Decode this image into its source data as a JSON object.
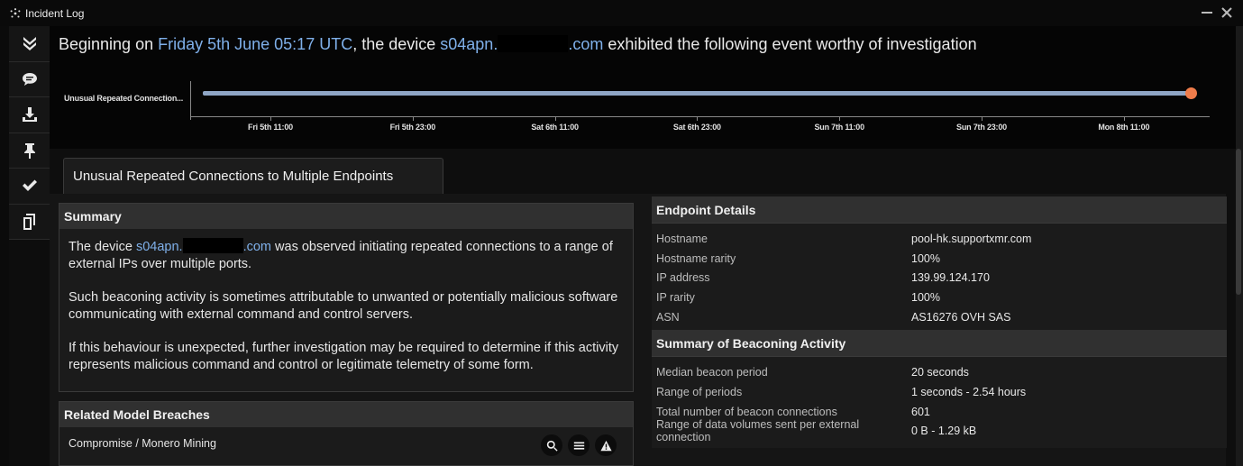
{
  "window": {
    "title": "Incident Log"
  },
  "sidebar": {
    "items": [
      {
        "icon": "collapse-chevrons-icon",
        "label": "Collapse"
      },
      {
        "icon": "comment-icon",
        "label": "Comment"
      },
      {
        "icon": "download-icon",
        "label": "Download"
      },
      {
        "icon": "pin-icon",
        "label": "Pin"
      },
      {
        "icon": "checkmark-icon",
        "label": "Acknowledge"
      },
      {
        "icon": "copy-icon",
        "label": "Copy"
      }
    ]
  },
  "headline": {
    "prefix": "Beginning on ",
    "date": "Friday 5th June 05:17 UTC",
    "middle": ", the device ",
    "device_prefix": "s04apn.",
    "device_suffix": ".com",
    "suffix": " exhibited the following event worthy of investigation"
  },
  "timeline": {
    "label": "Unusual Repeated Connection...",
    "dates": [
      "Fri 5th 11:00",
      "Fri 5th 23:00",
      "Sat 6th 11:00",
      "Sat 6th 23:00",
      "Sun 7th 11:00",
      "Sun 7th 23:00",
      "Mon 8th 11:00"
    ]
  },
  "tab": {
    "label": "Unusual Repeated Connections to Multiple Endpoints"
  },
  "summary": {
    "header": "Summary",
    "p1_prefix": "The device ",
    "p1_device_prefix": "s04apn.",
    "p1_device_suffix": ".com",
    "p1_suffix": " was observed initiating repeated connections to a range of external IPs over multiple ports.",
    "p2": "Such beaconing activity is sometimes attributable to unwanted or potentially malicious software communicating with external command and control servers.",
    "p3": "If this behaviour is unexpected, further investigation may be required to determine if this activity represents malicious command and control or legitimate telemetry of some form."
  },
  "related": {
    "header": "Related Model Breaches",
    "row": "Compromise / Monero Mining"
  },
  "endpoint": {
    "header": "Endpoint Details",
    "rows": [
      {
        "k": "Hostname",
        "v": "pool-hk.supportxmr.com"
      },
      {
        "k": "Hostname rarity",
        "v": "100%"
      },
      {
        "k": "IP address",
        "v": "139.99.124.170"
      },
      {
        "k": "IP rarity",
        "v": "100%"
      },
      {
        "k": "ASN",
        "v": "AS16276 OVH SAS"
      }
    ]
  },
  "beaconing": {
    "header": "Summary of Beaconing Activity",
    "rows": [
      {
        "k": "Median beacon period",
        "v": "20 seconds"
      },
      {
        "k": "Range of periods",
        "v": "1 seconds - 2.54 hours"
      },
      {
        "k": "Total number of beacon connections",
        "v": "601"
      },
      {
        "k": "Range of data volumes sent per external connection",
        "v": "0 B - 1.29 kB"
      }
    ]
  },
  "colors": {
    "link": "#7fb0ea",
    "timeline_bar": "#8fa6c6",
    "event_dot": "#f07c4a"
  }
}
